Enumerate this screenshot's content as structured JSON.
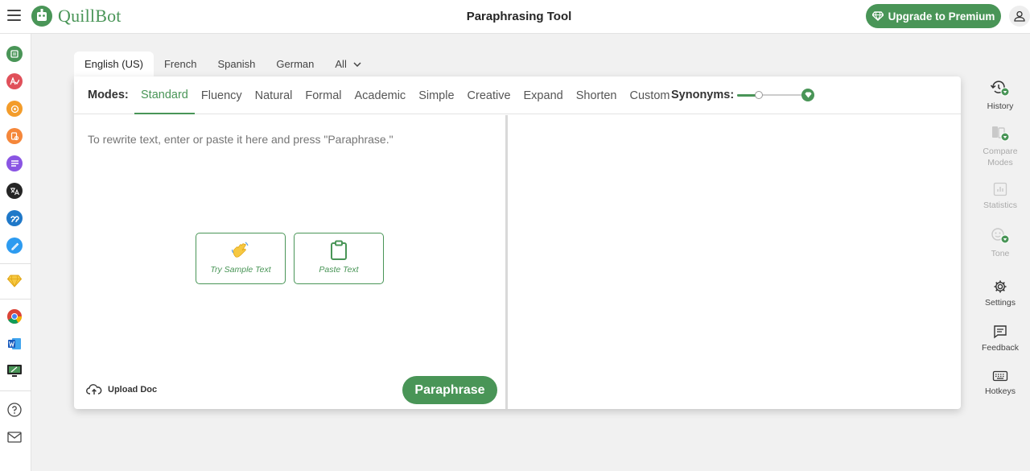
{
  "app": {
    "logo_text": "QuillBot",
    "page_title": "Paraphrasing Tool"
  },
  "header": {
    "upgrade_label": "Upgrade to Premium"
  },
  "colors": {
    "brand_green": "#499557"
  },
  "left_rail": {
    "items": [
      {
        "icon": "paraphraser-icon",
        "color": "#499557"
      },
      {
        "icon": "grammar-checker-icon",
        "color": "#e0505a"
      },
      {
        "icon": "ai-detector-icon",
        "color": "#f39c2a"
      },
      {
        "icon": "plagiarism-checker-icon",
        "color": "#f5873a"
      },
      {
        "icon": "summarizer-icon",
        "color": "#8a55e3"
      },
      {
        "icon": "translator-icon",
        "color": "#252525"
      },
      {
        "icon": "citation-generator-icon",
        "color": "#1f78c8"
      },
      {
        "icon": "co-writer-icon",
        "color": "#2d9bf0"
      }
    ],
    "premium_icon": "diamond-icon",
    "apps": [
      "chrome-icon",
      "word-icon",
      "desktop-icon"
    ],
    "bottom": [
      "help-icon",
      "mail-icon"
    ]
  },
  "languages": {
    "tabs": [
      "English (US)",
      "French",
      "Spanish",
      "German",
      "All"
    ],
    "active": "English (US)"
  },
  "modes": {
    "label": "Modes:",
    "items": [
      "Standard",
      "Fluency",
      "Natural",
      "Formal",
      "Academic",
      "Simple",
      "Creative",
      "Expand",
      "Shorten",
      "Custom"
    ],
    "active": "Standard"
  },
  "synonyms": {
    "label": "Synonyms:",
    "level": 0.33
  },
  "editor": {
    "placeholder": "To rewrite text, enter or paste it here and press \"Paraphrase.\"",
    "try_sample_label": "Try Sample Text",
    "paste_label": "Paste Text",
    "upload_label": "Upload Doc",
    "paraphrase_label": "Paraphrase"
  },
  "right_panel": {
    "items": [
      {
        "label": "History",
        "icon": "history-icon",
        "enabled": true
      },
      {
        "label": "Compare Modes",
        "icon": "compare-modes-icon",
        "enabled": false
      },
      {
        "label": "Statistics",
        "icon": "statistics-icon",
        "enabled": false
      },
      {
        "label": "Tone",
        "icon": "tone-icon",
        "enabled": false
      },
      {
        "label": "Settings",
        "icon": "settings-icon",
        "enabled": true
      },
      {
        "label": "Feedback",
        "icon": "feedback-icon",
        "enabled": true
      },
      {
        "label": "Hotkeys",
        "icon": "hotkeys-icon",
        "enabled": true
      }
    ]
  }
}
